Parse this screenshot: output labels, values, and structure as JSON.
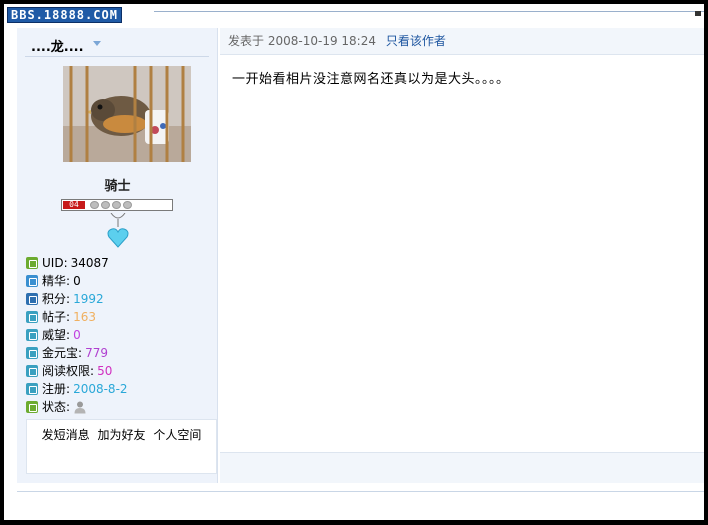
{
  "watermark": "BBS.18888.COM",
  "user": {
    "name": "....龙....",
    "rank": "骑士",
    "level": "04",
    "stats": [
      {
        "label": "UID",
        "value": "34087",
        "icon": "uid-icon",
        "icon_color": "#6cab2f",
        "value_color": "#000000"
      },
      {
        "label": "精华",
        "value": "0",
        "icon": "essence-icon",
        "icon_color": "#3a8fd0",
        "value_color": "#000000"
      },
      {
        "label": "积分",
        "value": "1992",
        "icon": "points-icon",
        "icon_color": "#2e6fb0",
        "value_color": "#2aa8d8"
      },
      {
        "label": "帖子",
        "value": "163",
        "icon": "posts-icon",
        "icon_color": "#3aa0c0",
        "value_color": "#f0b060"
      },
      {
        "label": "威望",
        "value": "0",
        "icon": "prestige-icon",
        "icon_color": "#3aa0c0",
        "value_color": "#c040e0"
      },
      {
        "label": "金元宝",
        "value": "779",
        "icon": "gold-icon",
        "icon_color": "#3aa0c0",
        "value_color": "#b040d0"
      },
      {
        "label": "阅读权限",
        "value": "50",
        "icon": "read-permission-icon",
        "icon_color": "#3aa0c0",
        "value_color": "#d030c0"
      },
      {
        "label": "注册",
        "value": "2008-8-2",
        "icon": "register-icon",
        "icon_color": "#3aa0c0",
        "value_color": "#2aa8d8"
      },
      {
        "label": "状态",
        "value": "",
        "icon": "status-icon",
        "icon_color": "#6cab2f",
        "value_color": "#000000"
      }
    ],
    "actions": [
      "发短消息",
      "加为好友",
      "个人空间"
    ]
  },
  "post": {
    "posted_label": "发表于",
    "timestamp": "2008-10-19 18:24",
    "author_only": "只看该作者",
    "body": "一开始看相片没注意网名还真以为是大头。。。。"
  }
}
